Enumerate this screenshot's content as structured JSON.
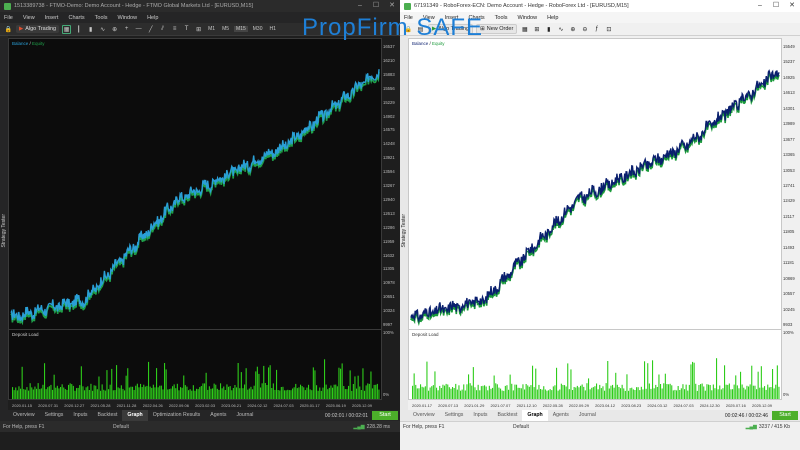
{
  "left": {
    "title": "1513389738 - FTMO-Demo: Demo Account - Hedge - FTMO Global Markets Ltd - [EURUSD,M15]",
    "menu": [
      "File",
      "View",
      "Insert",
      "Charts",
      "Tools",
      "Window",
      "Help"
    ],
    "algo_label": "Algo Trading",
    "timeframes": [
      "M1",
      "M5",
      "M15",
      "M30",
      "H1"
    ],
    "legend_balance": "Balance",
    "legend_equity": "Equity",
    "deposit_label": "Deposit Load",
    "sidebar_label": "Strategy Tester",
    "axis_labels": [
      "16537",
      "16210",
      "15883",
      "15556",
      "15229",
      "14902",
      "14575",
      "14248",
      "13921",
      "13594",
      "13267",
      "12940",
      "12613",
      "12286",
      "11959",
      "11632",
      "11305",
      "10978",
      "10651",
      "10324",
      "9997"
    ],
    "load_top": "100%",
    "load_bottom": "0%",
    "dates": [
      "2020.01.15",
      "2020.07.31",
      "2020.12.27",
      "2021.05.28",
      "2021.11.28",
      "2022.04.26",
      "2022.09.06",
      "2023.02.03",
      "2023.06.21",
      "2024.02.12",
      "2024.07.03",
      "2025.01.17",
      "2025.06.19",
      "2025.12.09"
    ],
    "tabs": [
      "Overview",
      "Settings",
      "Inputs",
      "Backtest",
      "Graph",
      "Optimization Results",
      "Agents",
      "Journal"
    ],
    "active_tab": "Graph",
    "timer": "00:02:01 / 00:02:01",
    "start": "Start",
    "status_help": "For Help, press F1",
    "status_profile": "Default",
    "status_traffic": "228.28 ms"
  },
  "right": {
    "title": "67191349 - RoboForex-ECN: Demo Account - Hedge - RoboForex Ltd - [EURUSD,M15]",
    "menu": [
      "File",
      "View",
      "Insert",
      "Charts",
      "Tools",
      "Window",
      "Help"
    ],
    "algo_label": "Algo Trading",
    "new_order_label": "New Order",
    "legend_balance": "Balance",
    "legend_equity": "Equity",
    "deposit_label": "Deposit Load",
    "sidebar_label": "Strategy Tester",
    "axis_labels": [
      "15549",
      "15237",
      "14925",
      "14613",
      "14301",
      "13989",
      "13677",
      "13365",
      "13053",
      "12741",
      "12429",
      "12117",
      "11805",
      "11493",
      "11181",
      "10869",
      "10557",
      "10245",
      "9933"
    ],
    "load_top": "100%",
    "load_bottom": "0%",
    "dates": [
      "2020.01.17",
      "2020.07.13",
      "2021.01.29",
      "2021.07.07",
      "2021.12.10",
      "2022.05.28",
      "2022.09.29",
      "2023.04.12",
      "2023.08.23",
      "2024.03.12",
      "2024.07.03",
      "2024.12.30",
      "2025.07.16",
      "2025.12.09"
    ],
    "tabs": [
      "Overview",
      "Settings",
      "Inputs",
      "Backtest",
      "Graph",
      "Agents",
      "Journal"
    ],
    "active_tab": "Graph",
    "timer": "00:02:46 / 00:02:46",
    "start": "Start",
    "status_help": "For Help, press F1",
    "status_profile": "Default",
    "status_traffic": "3237 / 415 Kb"
  },
  "overlay_text": "PropFirm SAFE",
  "colors": {
    "left_balance": "#2a9fd6",
    "left_equity": "#1fa04a",
    "right_balance": "#0a1f6e",
    "right_equity": "#1a9a3a",
    "load_bar": "#2ecc1a",
    "overlay": "#1e7fd6"
  }
}
